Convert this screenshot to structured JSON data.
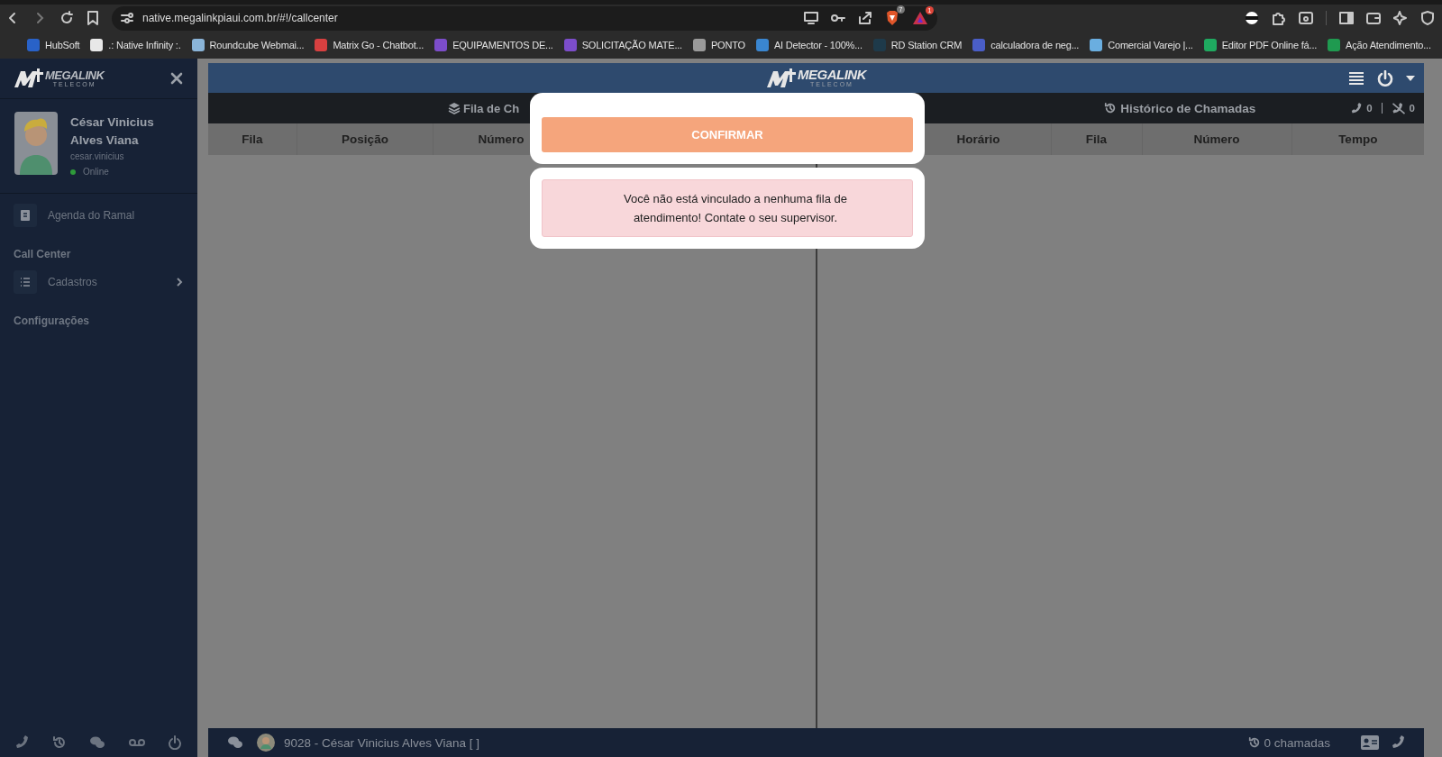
{
  "browser": {
    "url": "native.megalinkpiaui.com.br/#!/callcenter",
    "badges": [
      "7",
      "1"
    ],
    "bookmarks": [
      {
        "label": "HubSoft",
        "color": "#2962c8"
      },
      {
        "label": ".: Native Infinity :.",
        "color": "#e8e8e8"
      },
      {
        "label": "Roundcube Webmai...",
        "color": "#8ab4d8"
      },
      {
        "label": "Matrix Go - Chatbot...",
        "color": "#d84040"
      },
      {
        "label": "EQUIPAMENTOS DE...",
        "color": "#7c4dca"
      },
      {
        "label": "SOLICITAÇÃO MATE...",
        "color": "#7c4dca"
      },
      {
        "label": "PONTO",
        "color": "#9a9a9a"
      },
      {
        "label": "AI Detector - 100%...",
        "color": "#3a86d0"
      },
      {
        "label": "RD Station CRM",
        "color": "#1e3a4a"
      },
      {
        "label": "calculadora de neg...",
        "color": "#4a5ec8"
      },
      {
        "label": "Comercial Varejo |...",
        "color": "#6aaee0"
      },
      {
        "label": "Editor PDF Online fá...",
        "color": "#1faa60"
      },
      {
        "label": "Ação Atendimento...",
        "color": "#1f9a50"
      }
    ]
  },
  "sidebar": {
    "logo": {
      "name": "MEGALINK",
      "sub": "TELECOM"
    },
    "user": {
      "name": "César Vinicius Alves Viana",
      "username": "cesar.vinicius",
      "status": "Online",
      "online": true
    },
    "menu": [
      {
        "kind": "item",
        "label": "Agenda do Ramal",
        "arrow": false
      },
      {
        "kind": "section",
        "label": "Call Center"
      },
      {
        "kind": "item",
        "label": "Cadastros",
        "arrow": true
      },
      {
        "kind": "section",
        "label": "Configurações"
      }
    ]
  },
  "header": {
    "logo": {
      "name": "MEGALINK",
      "sub": "TELECOM"
    }
  },
  "queue_panel": {
    "title": "Fila de Ch",
    "columns": [
      "Fila",
      "Posição",
      "Número"
    ]
  },
  "history_panel": {
    "title": "Histórico de Chamadas",
    "counters": [
      "0",
      "0"
    ],
    "columns": [
      "Horário",
      "Fila",
      "Número",
      "Tempo"
    ]
  },
  "modal": {
    "button": "CONFIRMAR",
    "message": "Você não está vinculado a nenhuma fila de atendimento! Contate o seu supervisor."
  },
  "status_bar": {
    "user": "9028 - César Vinicius Alves Viana [ ]",
    "calls": "0 chamadas"
  }
}
